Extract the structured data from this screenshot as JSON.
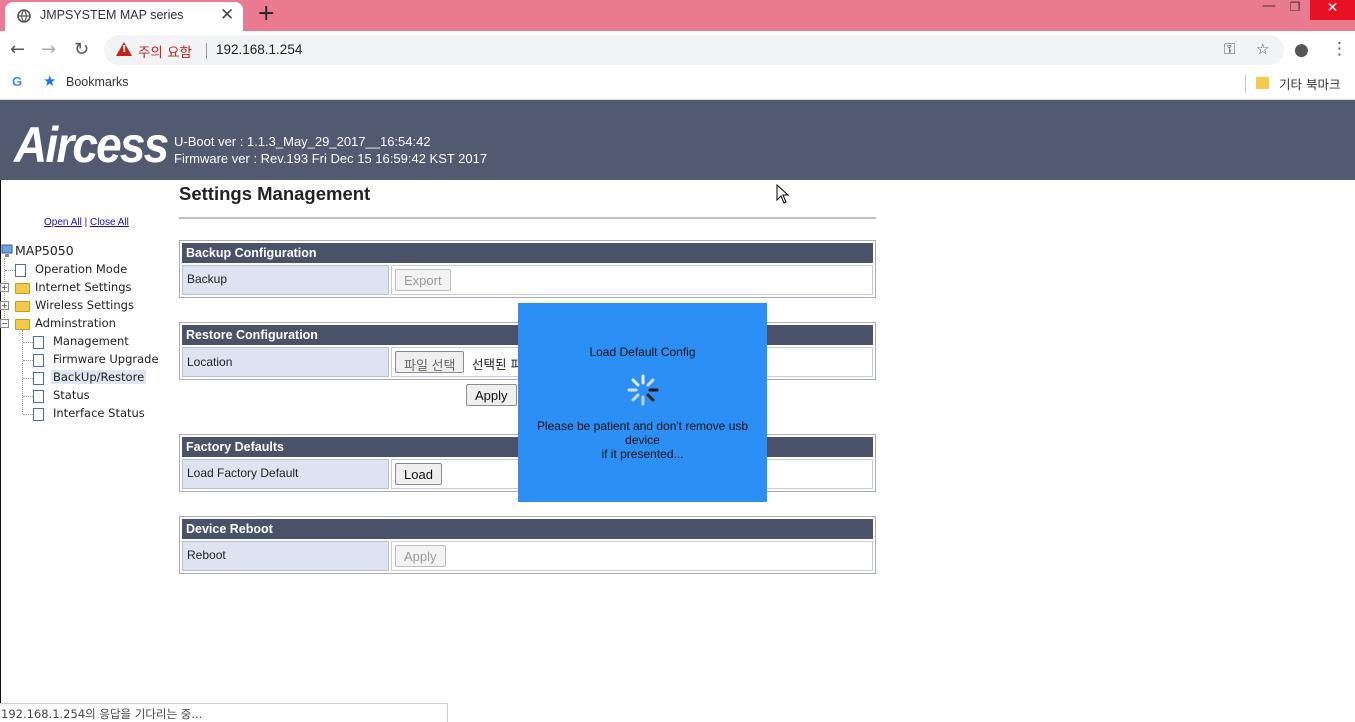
{
  "browser": {
    "tab_title": "JMPSYSTEM MAP series",
    "tab_close": "✕",
    "new_tab": "+",
    "window_controls": {
      "minimize": "—",
      "maximize": "❐",
      "close": "✕"
    },
    "security_warning": "주의 요함",
    "url": "192.168.1.254",
    "bookmarks_label": "Bookmarks",
    "other_bookmarks": "기타 북마크",
    "status_text": "192.168.1.254의 응답을 기다리는 중..."
  },
  "header": {
    "logo": "Aircess",
    "uboot_version": "U-Boot ver : 1.1.3_May_29_2017__16:54:42",
    "firmware_version": "Firmware ver : Rev.193 Fri Dec 15 16:59:42 KST 2017"
  },
  "tree": {
    "open_all": "Open All",
    "separator": "|",
    "close_all": "Close All",
    "root": "MAP5050",
    "items": [
      {
        "label": "Operation Mode"
      },
      {
        "label": "Internet Settings"
      },
      {
        "label": "Wireless Settings"
      },
      {
        "label": "Adminstration"
      },
      {
        "label": "Management"
      },
      {
        "label": "Firmware Upgrade"
      },
      {
        "label": "BackUp/Restore"
      },
      {
        "label": "Status"
      },
      {
        "label": "Interface Status"
      }
    ],
    "selected_item": "BackUp/Restore"
  },
  "main": {
    "title": "Settings Management",
    "backup": {
      "header": "Backup Configuration",
      "label": "Backup",
      "button": "Export"
    },
    "restore": {
      "header": "Restore Configuration",
      "label": "Location",
      "file_button": "파일 선택",
      "file_status": "선택된 파",
      "apply": "Apply"
    },
    "factory": {
      "header": "Factory Defaults",
      "label": "Load Factory Default",
      "button": "Load"
    },
    "reboot": {
      "header": "Device Reboot",
      "label": "Reboot",
      "button": "Apply"
    }
  },
  "modal": {
    "title": "Load Default Config",
    "message_line1": "Please be patient and don't remove usb device",
    "message_line2": "if it presented..."
  },
  "colors": {
    "tab_strip": "#ea7a8f",
    "header_bg": "#525a72",
    "section_header": "#4a526a",
    "label_cell": "#dde3f1",
    "modal_bg": "#2b8ff5"
  }
}
